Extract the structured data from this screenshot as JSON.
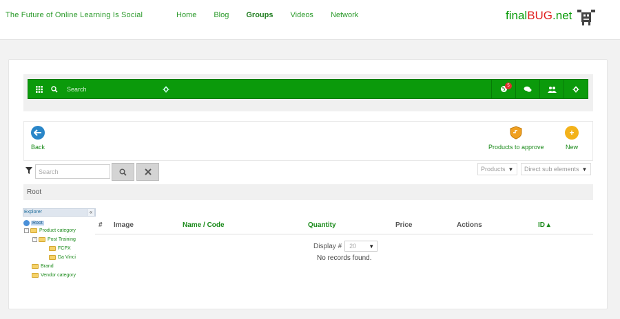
{
  "site": {
    "tagline": "The Future of Online Learning Is Social",
    "brand_prefix": "final",
    "brand_bug": "BUG",
    "brand_suffix": ".net",
    "nav": [
      {
        "label": "Home",
        "active": false
      },
      {
        "label": "Blog",
        "active": false
      },
      {
        "label": "Groups",
        "active": true
      },
      {
        "label": "Videos",
        "active": false
      },
      {
        "label": "Network",
        "active": false
      }
    ]
  },
  "toolbar": {
    "search_placeholder": "Search",
    "notification_count": "5",
    "accent_color": "#0b9a0b"
  },
  "actions": {
    "back_label": "Back",
    "products_to_approve_label": "Products to approve",
    "new_label": "New"
  },
  "filter": {
    "search_placeholder": "Search",
    "products_dropdown": "Products",
    "sub_elements_dropdown": "Direct sub elements"
  },
  "breadcrumb": "Root",
  "explorer": {
    "title": "Explorer",
    "collapse_symbol": "«",
    "nodes": {
      "root": "Root",
      "product_category": "Product category",
      "post_training": "Post Training",
      "fcpx": "FCPX",
      "da_vinci": "Da Vinci",
      "brand": "Brand",
      "vendor_category": "Vendor category"
    }
  },
  "grid": {
    "columns": {
      "num": "#",
      "image": "Image",
      "name_code": "Name / Code",
      "quantity": "Quantity",
      "price": "Price",
      "actions": "Actions",
      "id": "ID ▴"
    },
    "display_label": "Display #",
    "display_value": "20",
    "empty_message": "No records found."
  }
}
